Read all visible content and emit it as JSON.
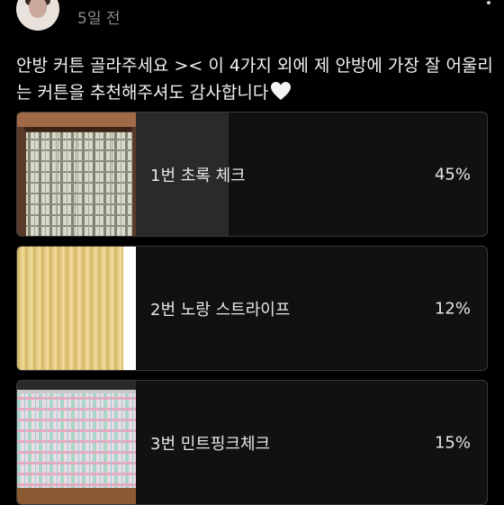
{
  "header": {
    "time": "5일 전",
    "avatar_icon": "avatar",
    "more_icon": "more-dots-icon"
  },
  "post": {
    "text": "안방 커튼 골라주세요 >< 이 4가지 외에 제 안방에 가장 잘 어울리는 커튼을 추천해주셔도 감사합니다",
    "emoji": "white-heart-icon"
  },
  "poll": {
    "options": [
      {
        "label": "1번 초록 체크",
        "percent": "45%",
        "value": 45
      },
      {
        "label": "2번 노랑 스트라이프",
        "percent": "12%",
        "value": 12
      },
      {
        "label": "3번 민트핑크체크",
        "percent": "15%",
        "value": 15
      }
    ]
  },
  "colors": {
    "background": "#000000",
    "bar_fill": "#2a2a2a",
    "border": "#3a3a3a",
    "muted_text": "#8c8c8c"
  }
}
